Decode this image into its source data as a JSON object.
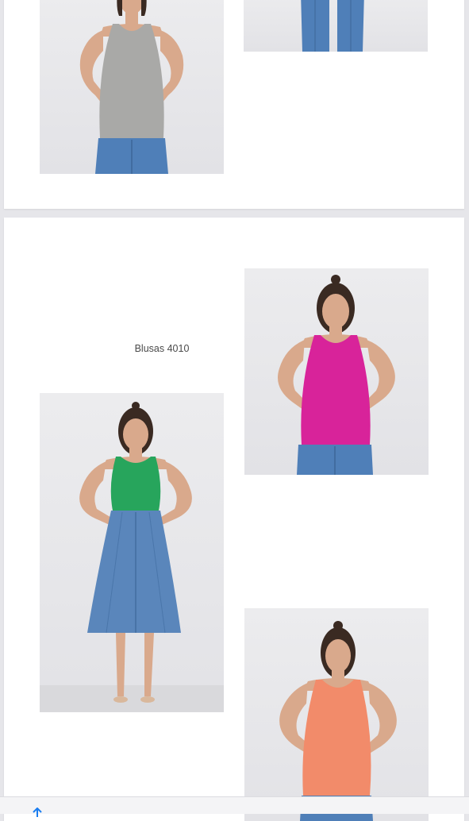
{
  "catalog": {
    "caption": "Blusas 4010"
  },
  "products": [
    {
      "name": "gray-halter-top",
      "top_color": "#a9a9a7"
    },
    {
      "name": "jeans-partial"
    },
    {
      "name": "green-halter-top",
      "top_color": "#27a55c",
      "bottom": "denim-skirt"
    },
    {
      "name": "magenta-halter-top",
      "top_color": "#d8239a"
    },
    {
      "name": "coral-halter-top",
      "top_color": "#f28b6a"
    }
  ],
  "colors": {
    "background": "#e6e6ea",
    "page": "#ffffff",
    "denim": "#4f7fb8",
    "skin": "#d9a98c",
    "hair": "#3a2a22"
  },
  "toolbar": {
    "share_icon": "share-icon"
  }
}
